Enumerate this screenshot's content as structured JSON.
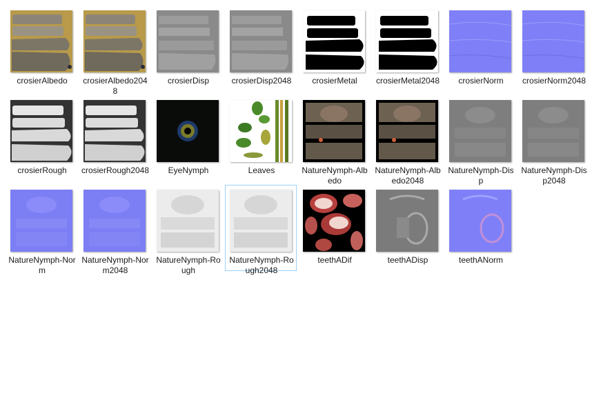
{
  "files": [
    {
      "label": "crosierAlbedo",
      "thumb": "albedo"
    },
    {
      "label": "crosierAlbedo2048",
      "thumb": "albedo"
    },
    {
      "label": "crosierDisp",
      "thumb": "disp"
    },
    {
      "label": "crosierDisp2048",
      "thumb": "disp"
    },
    {
      "label": "crosierMetal",
      "thumb": "metal"
    },
    {
      "label": "crosierMetal2048",
      "thumb": "metal"
    },
    {
      "label": "crosierNorm",
      "thumb": "norm"
    },
    {
      "label": "crosierNorm2048",
      "thumb": "norm"
    },
    {
      "label": "crosierRough",
      "thumb": "rough"
    },
    {
      "label": "crosierRough2048",
      "thumb": "rough"
    },
    {
      "label": "EyeNymph",
      "thumb": "eye"
    },
    {
      "label": "Leaves",
      "thumb": "leaves"
    },
    {
      "label": "NatureNymph-Albedo",
      "thumb": "nnalbedo"
    },
    {
      "label": "NatureNymph-Albedo2048",
      "thumb": "nnalbedo"
    },
    {
      "label": "NatureNymph-Disp",
      "thumb": "nndisp"
    },
    {
      "label": "NatureNymph-Disp2048",
      "thumb": "nndisp"
    },
    {
      "label": "NatureNymph-Norm",
      "thumb": "nnnorm"
    },
    {
      "label": "NatureNymph-Norm2048",
      "thumb": "nnnorm"
    },
    {
      "label": "NatureNymph-Rough",
      "thumb": "nnrough"
    },
    {
      "label": "NatureNymph-Rough2048",
      "thumb": "nnrough",
      "selected": true
    },
    {
      "label": "teethADif",
      "thumb": "teeth"
    },
    {
      "label": "teethADisp",
      "thumb": "teethdisp"
    },
    {
      "label": "teethANorm",
      "thumb": "teethnorm"
    }
  ],
  "colors": {
    "selection_border": "#99d1ff",
    "label_text": "#1a1a1a",
    "background": "#ffffff"
  }
}
